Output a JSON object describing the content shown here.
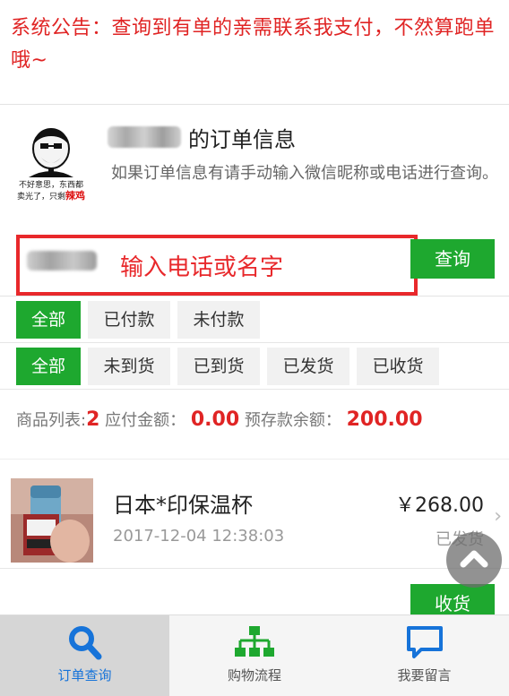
{
  "notice": {
    "text": "系统公告：查询到有单的亲需联系我支付，不然算跑单哦~"
  },
  "profile": {
    "title": "的订单信息",
    "hint": "如果订单信息有请手动输入微信昵称或电话进行查询。",
    "logo_caption_line1": "不好意思，东西都",
    "logo_caption_line2a": "卖光了，只剩",
    "logo_caption_hot": "辣鸡"
  },
  "search": {
    "placeholder": "输入电话或名字",
    "button": "查询"
  },
  "filters": {
    "payment": [
      "全部",
      "已付款",
      "未付款"
    ],
    "shipping": [
      "全部",
      "未到货",
      "已到货",
      "已发货",
      "已收货"
    ]
  },
  "summary": {
    "list_label": "商品列表:",
    "count": "2",
    "payable_label": "应付金额：",
    "payable": "0.00",
    "deposit_label": "预存款余额：",
    "deposit": "200.00"
  },
  "order": {
    "name": "日本*印保温杯",
    "time": "2017-12-04 12:38:03",
    "price": "￥268.00",
    "status": "已发货",
    "receive": "收货"
  },
  "tabs": [
    {
      "label": "订单查询",
      "icon": "search-icon"
    },
    {
      "label": "购物流程",
      "icon": "flowchart-icon"
    },
    {
      "label": "我要留言",
      "icon": "message-icon"
    }
  ],
  "colors": {
    "accent_green": "#1ea82f",
    "notice_red": "#e02424",
    "tab_active": "#1673d9"
  }
}
